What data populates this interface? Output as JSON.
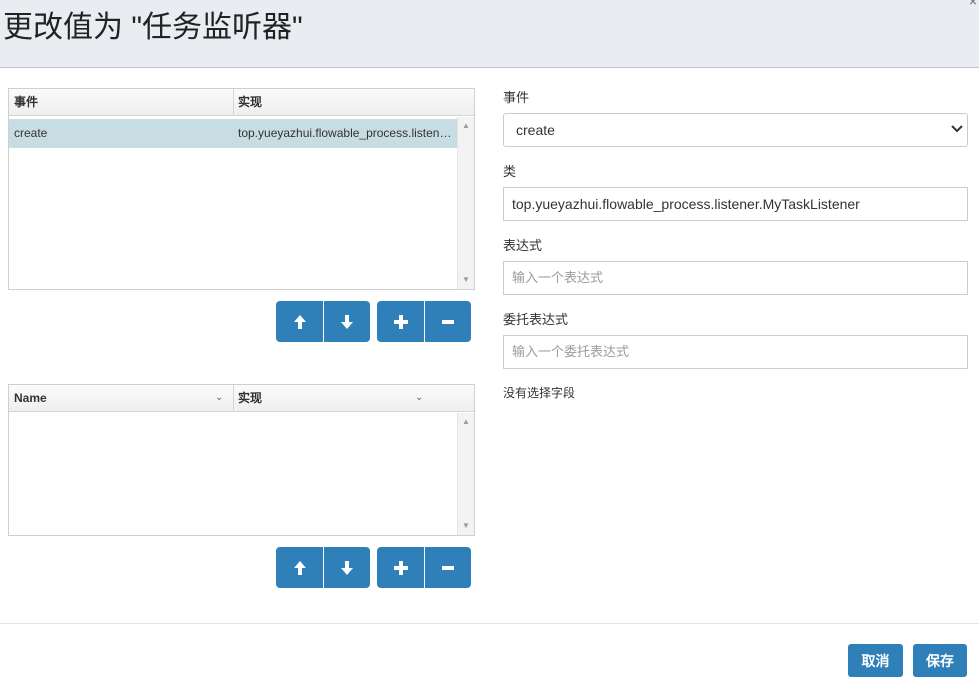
{
  "header": {
    "title": "更改值为 \"任务监听器\"",
    "close_symbol": "×"
  },
  "listeners_grid": {
    "columns": [
      "事件",
      "实现"
    ],
    "rows": [
      {
        "event": "create",
        "implementation": "top.yueyazhui.flowable_process.listener.MyTaskListener"
      }
    ]
  },
  "fields_grid": {
    "columns": [
      "Name",
      "实现"
    ]
  },
  "buttons": {
    "up": "🡅",
    "down": "🡇",
    "add": "+",
    "remove": "−"
  },
  "form": {
    "event_label": "事件",
    "event_value": "create",
    "class_label": "类",
    "class_value": "top.yueyazhui.flowable_process.listener.MyTaskListener",
    "expression_label": "表达式",
    "expression_placeholder": "输入一个表达式",
    "delegate_label": "委托表达式",
    "delegate_placeholder": "输入一个委托表达式",
    "no_field_text": "没有选择字段"
  },
  "footer": {
    "cancel_label": "取消",
    "save_label": "保存"
  },
  "colors": {
    "primary": "#2f7fb8",
    "selected_row": "#c8dde3",
    "header_bg": "#e9edf1"
  }
}
